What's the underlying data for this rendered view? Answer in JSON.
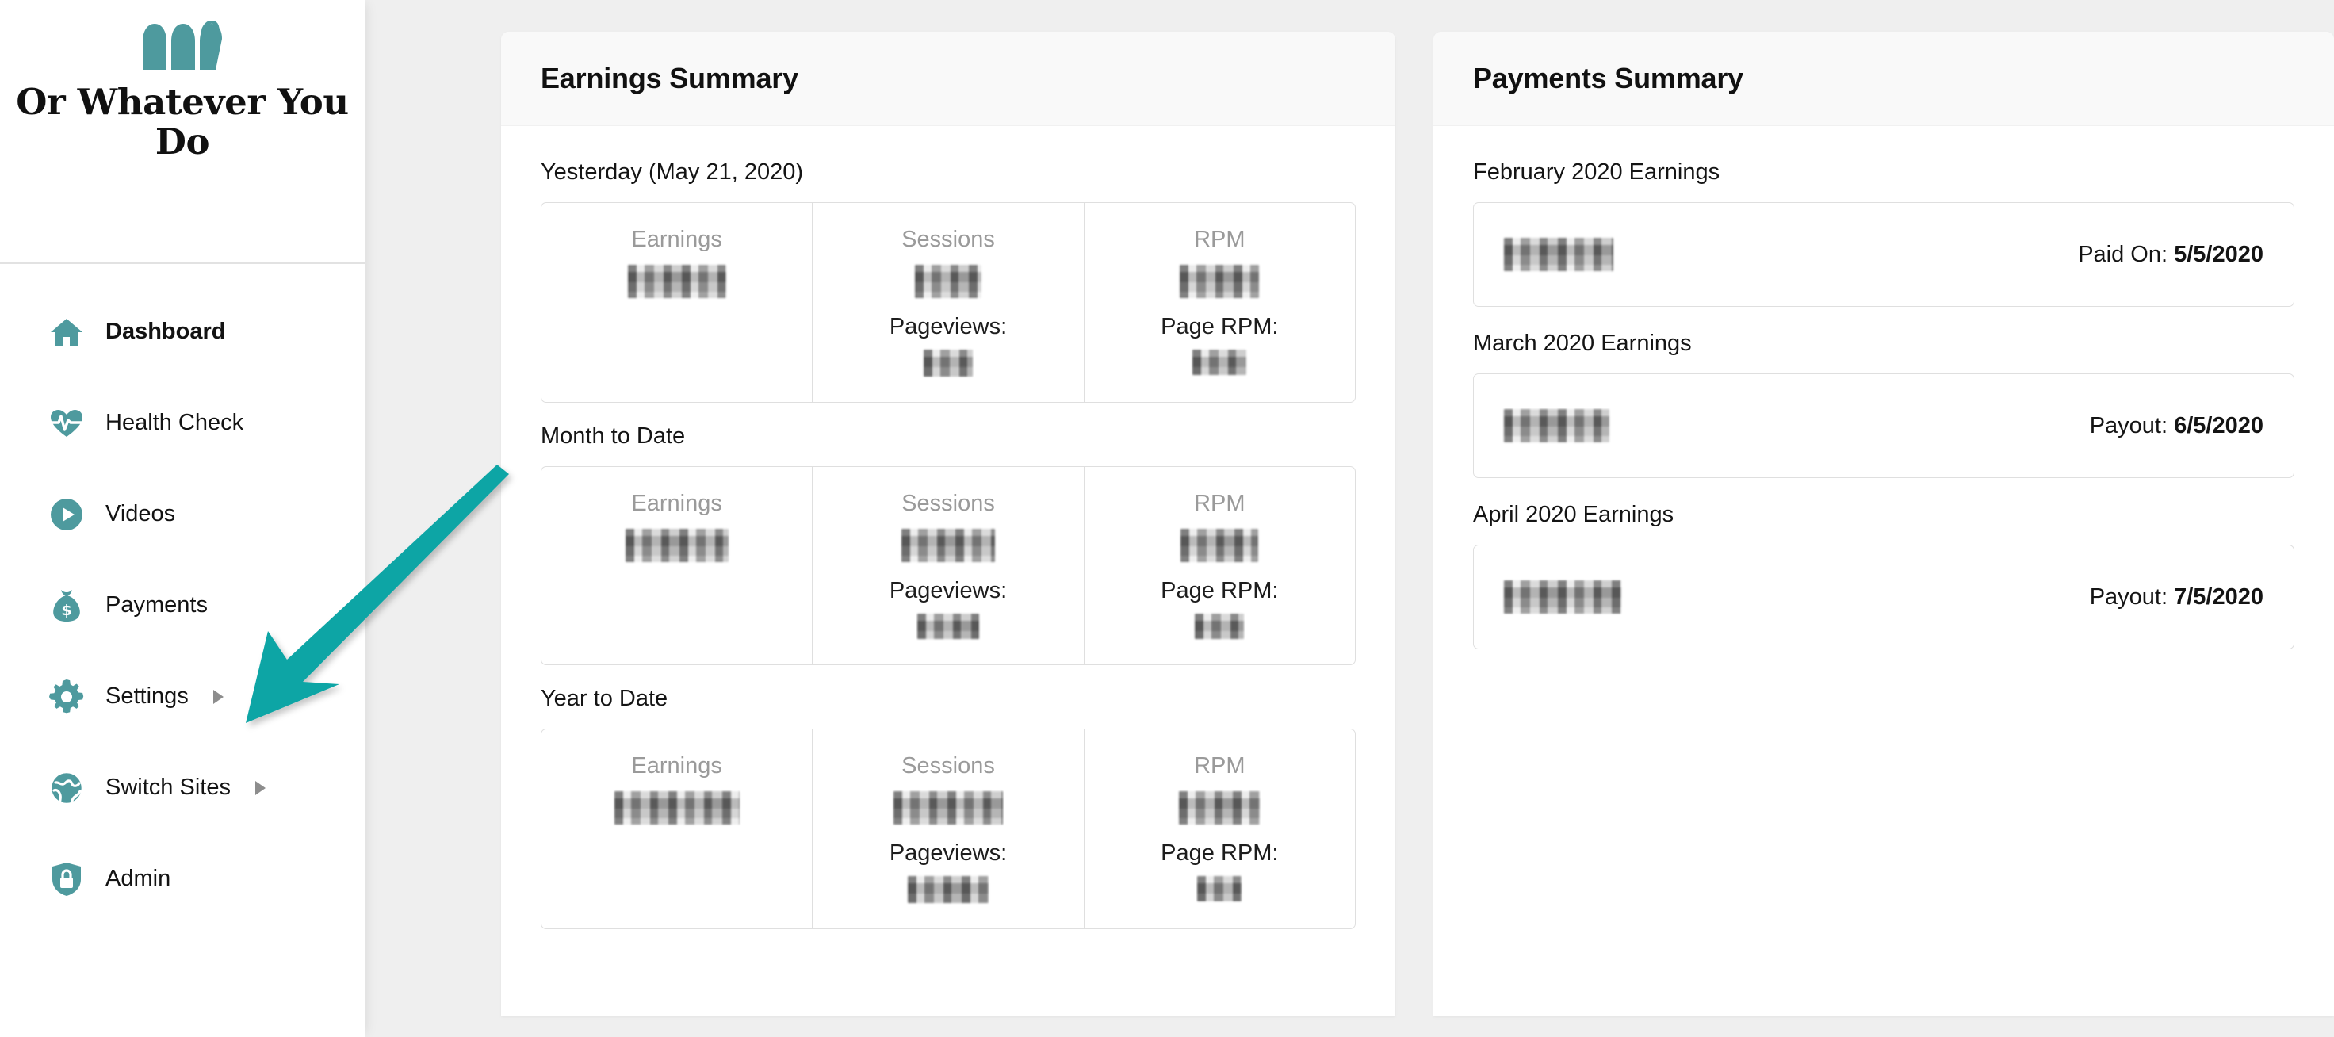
{
  "brand": {
    "logo_icon": "three-bars-leaf-logo",
    "name": "Or Whatever You Do"
  },
  "sidebar": {
    "items": [
      {
        "label": "Dashboard",
        "icon": "home-icon",
        "active": true,
        "has_submenu": false
      },
      {
        "label": "Health Check",
        "icon": "heartbeat-icon",
        "active": false,
        "has_submenu": false
      },
      {
        "label": "Videos",
        "icon": "play-circle-icon",
        "active": false,
        "has_submenu": false
      },
      {
        "label": "Payments",
        "icon": "money-bag-icon",
        "active": false,
        "has_submenu": false
      },
      {
        "label": "Settings",
        "icon": "gear-icon",
        "active": false,
        "has_submenu": true
      },
      {
        "label": "Switch Sites",
        "icon": "globe-icon",
        "active": false,
        "has_submenu": true
      },
      {
        "label": "Admin",
        "icon": "shield-lock-icon",
        "active": false,
        "has_submenu": false
      }
    ]
  },
  "annotation": {
    "arrow_icon": "teal-arrow-pointing-down-left",
    "color": "#0FA5A5",
    "points_to": "Settings"
  },
  "earnings": {
    "title": "Earnings Summary",
    "periods": [
      {
        "label": "Yesterday (May 21, 2020)",
        "cells": [
          {
            "name": "Earnings",
            "value": "redacted",
            "sub_label": null,
            "sub_value": null
          },
          {
            "name": "Sessions",
            "value": "redacted",
            "sub_label": "Pageviews:",
            "sub_value": "redacted"
          },
          {
            "name": "RPM",
            "value": "redacted",
            "sub_label": "Page RPM:",
            "sub_value": "redacted"
          }
        ]
      },
      {
        "label": "Month to Date",
        "cells": [
          {
            "name": "Earnings",
            "value": "redacted",
            "sub_label": null,
            "sub_value": null
          },
          {
            "name": "Sessions",
            "value": "redacted",
            "sub_label": "Pageviews:",
            "sub_value": "redacted"
          },
          {
            "name": "RPM",
            "value": "redacted",
            "sub_label": "Page RPM:",
            "sub_value": "redacted"
          }
        ]
      },
      {
        "label": "Year to Date",
        "cells": [
          {
            "name": "Earnings",
            "value": "redacted",
            "sub_label": null,
            "sub_value": null
          },
          {
            "name": "Sessions",
            "value": "redacted",
            "sub_label": "Pageviews:",
            "sub_value": "redacted"
          },
          {
            "name": "RPM",
            "value": "redacted",
            "sub_label": "Page RPM:",
            "sub_value": "redacted"
          }
        ]
      }
    ]
  },
  "payments": {
    "title": "Payments Summary",
    "rows": [
      {
        "label": "February 2020 Earnings",
        "amount": "redacted",
        "date_label": "Paid On:",
        "date": "5/5/2020"
      },
      {
        "label": "March 2020 Earnings",
        "amount": "redacted",
        "date_label": "Payout:",
        "date": "6/5/2020"
      },
      {
        "label": "April 2020 Earnings",
        "amount": "redacted",
        "date_label": "Payout:",
        "date": "7/5/2020"
      }
    ]
  },
  "theme": {
    "accent_teal": "#4E9A9E",
    "arrow_teal": "#0FA5A5",
    "card_header_bg": "#F9F9F9",
    "page_bg": "#EFEFEF",
    "border": "#DFDFDF"
  }
}
